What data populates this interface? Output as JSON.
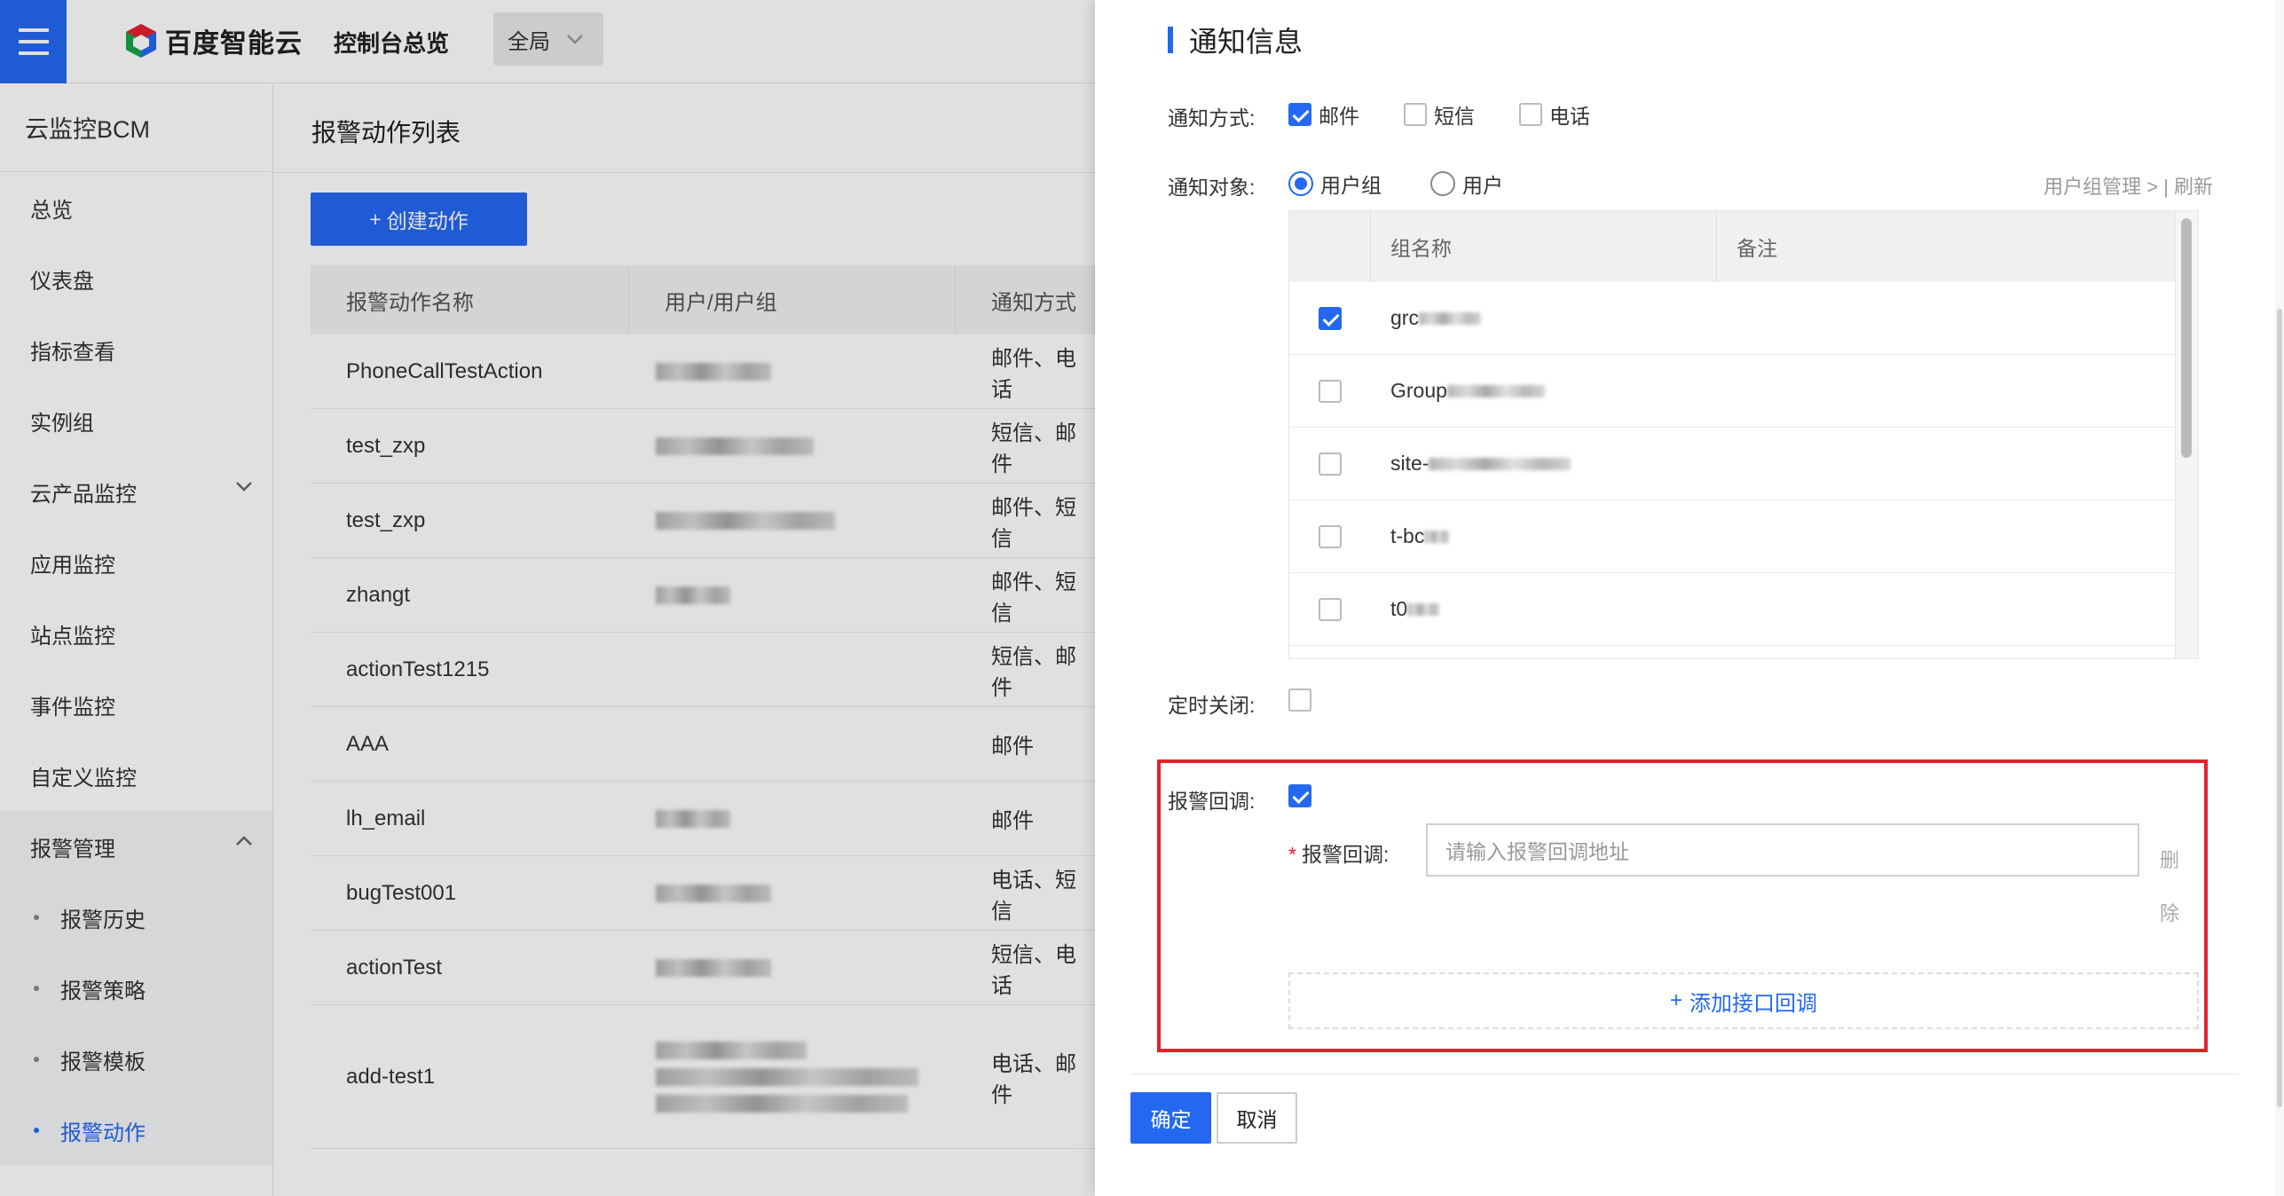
{
  "topbar": {
    "brand": "百度智能云",
    "console_title": "控制台总览",
    "region": "全局"
  },
  "sidebar": {
    "title": "云监控BCM",
    "items": [
      {
        "label": "总览"
      },
      {
        "label": "仪表盘"
      },
      {
        "label": "指标查看"
      },
      {
        "label": "实例组"
      },
      {
        "label": "云产品监控"
      },
      {
        "label": "应用监控"
      },
      {
        "label": "站点监控"
      },
      {
        "label": "事件监控"
      },
      {
        "label": "自定义监控"
      }
    ],
    "alarm_group": {
      "label": "报警管理",
      "subs": [
        {
          "label": "报警历史"
        },
        {
          "label": "报警策略"
        },
        {
          "label": "报警模板"
        },
        {
          "label": "报警动作"
        }
      ]
    }
  },
  "main": {
    "title": "报警动作列表",
    "create_label": "创建动作",
    "columns": [
      "报警动作名称",
      "用户/用户组",
      "通知方式"
    ],
    "rows": [
      {
        "name": "PhoneCallTestAction",
        "notify": "邮件、电话"
      },
      {
        "name": "test_zxp",
        "notify": "短信、邮件"
      },
      {
        "name": "test_zxp",
        "notify": "邮件、短信"
      },
      {
        "name": "zhangt",
        "notify": "邮件、短信"
      },
      {
        "name": "actionTest1215",
        "notify": "短信、邮件"
      },
      {
        "name": "AAA",
        "notify": "邮件"
      },
      {
        "name": "lh_email",
        "notify": "邮件"
      },
      {
        "name": "bugTest001",
        "notify": "电话、短信"
      },
      {
        "name": "actionTest",
        "notify": "短信、电话"
      },
      {
        "name": "add-test1",
        "notify": "电话、邮件"
      }
    ]
  },
  "drawer": {
    "section_title": "通知信息",
    "notify_method_label": "通知方式:",
    "methods": [
      {
        "label": "邮件",
        "checked": true
      },
      {
        "label": "短信",
        "checked": false
      },
      {
        "label": "电话",
        "checked": false
      }
    ],
    "notify_target_label": "通知对象:",
    "targets": [
      {
        "label": "用户组",
        "selected": true
      },
      {
        "label": "用户",
        "selected": false
      }
    ],
    "group_mgmt_link": "用户组管理 > | 刷新",
    "group_table": {
      "columns": [
        "组名称",
        "备注"
      ],
      "rows": [
        {
          "name": "grc",
          "checked": true
        },
        {
          "name": "Group",
          "checked": false
        },
        {
          "name": "site-",
          "checked": false
        },
        {
          "name": "t-bc",
          "checked": false
        },
        {
          "name": "t0",
          "checked": false
        }
      ]
    },
    "timed_close_label": "定时关闭:",
    "callback_label": "报警回调:",
    "callback_field_label": "报警回调:",
    "callback_required_mark": "*",
    "callback_placeholder": "请输入报警回调地址",
    "delete_label": "删除",
    "add_callback_label": "添加接口回调",
    "ok_label": "确定",
    "cancel_label": "取消"
  },
  "colors": {
    "accent": "#2468f2",
    "highlight_border": "#e5202b"
  }
}
